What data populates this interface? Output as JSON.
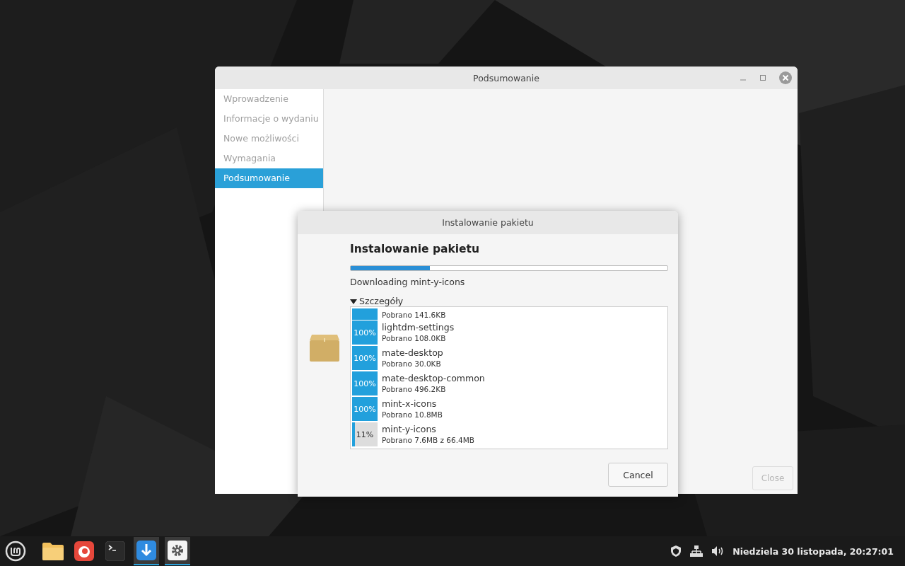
{
  "main_window": {
    "title": "Podsumowanie",
    "sidebar": [
      {
        "label": "Wprowadzenie",
        "selected": false
      },
      {
        "label": "Informacje o wydaniu",
        "selected": false
      },
      {
        "label": "Nowe możliwości",
        "selected": false
      },
      {
        "label": "Wymagania",
        "selected": false
      },
      {
        "label": "Podsumowanie",
        "selected": true
      }
    ],
    "close_button": {
      "label": "Close",
      "disabled": true
    }
  },
  "dialog": {
    "title": "Instalowanie pakietu",
    "heading": "Instalowanie pakietu",
    "progress": {
      "level": 0.25
    },
    "status": "Downloading mint-y-icons",
    "details": {
      "label": "Szczegóły",
      "expanded": true
    },
    "packages": [
      {
        "level": 1,
        "info": "Pobrano 141.6KB"
      },
      {
        "name": "lightdm-settings",
        "percent": "100%",
        "level": 1,
        "info": "Pobrano 108.0KB"
      },
      {
        "name": "mate-desktop",
        "percent": "100%",
        "level": 1,
        "info": "Pobrano 30.0KB"
      },
      {
        "name": "mate-desktop-common",
        "percent": "100%",
        "level": 1,
        "info": "Pobrano 496.2KB"
      },
      {
        "name": "mint-x-icons",
        "percent": "100%",
        "level": 1,
        "info": "Pobrano 10.8MB"
      },
      {
        "name": "mint-y-icons",
        "percent": "11%",
        "level": 0.11,
        "info": "Pobrano 7.6MB z 66.4MB"
      }
    ],
    "cancel_button": "Cancel"
  },
  "taskbar": {
    "apps": [
      {
        "kind": "folder",
        "running": false
      },
      {
        "kind": "browser",
        "running": false
      },
      {
        "kind": "terminal",
        "running": false
      },
      {
        "kind": "updater",
        "running": true
      },
      {
        "kind": "settings",
        "running": true
      }
    ],
    "clock": "Niedziela 30 listopada, 20:27:01"
  }
}
